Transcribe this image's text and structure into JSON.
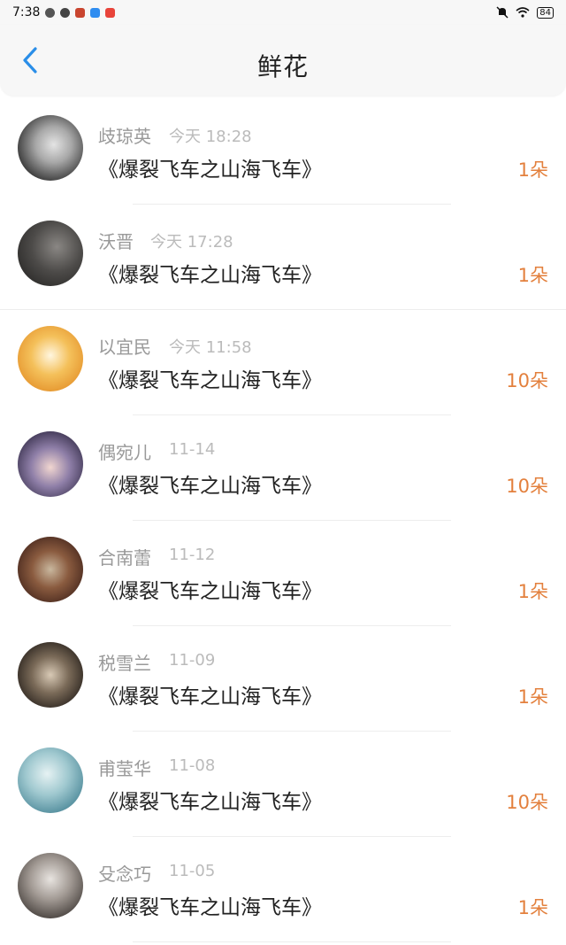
{
  "status_bar": {
    "time": "7:38",
    "battery": "84"
  },
  "header": {
    "title": "鲜花"
  },
  "items": [
    {
      "name": "歧琼英",
      "time": "今天 18:28",
      "title": "《爆裂飞车之山海飞车》",
      "amount": "1朵"
    },
    {
      "name": "沃晋",
      "time": "今天 17:28",
      "title": "《爆裂飞车之山海飞车》",
      "amount": "1朵"
    },
    {
      "name": "以宜民",
      "time": "今天 11:58",
      "title": "《爆裂飞车之山海飞车》",
      "amount": "10朵"
    },
    {
      "name": "偶宛儿",
      "time": "11-14",
      "title": "《爆裂飞车之山海飞车》",
      "amount": "10朵"
    },
    {
      "name": "合南蕾",
      "time": "11-12",
      "title": "《爆裂飞车之山海飞车》",
      "amount": "1朵"
    },
    {
      "name": "税雪兰",
      "time": "11-09",
      "title": "《爆裂飞车之山海飞车》",
      "amount": "1朵"
    },
    {
      "name": "甫莹华",
      "time": "11-08",
      "title": "《爆裂飞车之山海飞车》",
      "amount": "10朵"
    },
    {
      "name": "殳念巧",
      "time": "11-05",
      "title": "《爆裂飞车之山海飞车》",
      "amount": "1朵"
    }
  ],
  "colors": {
    "accent": "#2a8ee8",
    "amount": "#e3803d"
  }
}
